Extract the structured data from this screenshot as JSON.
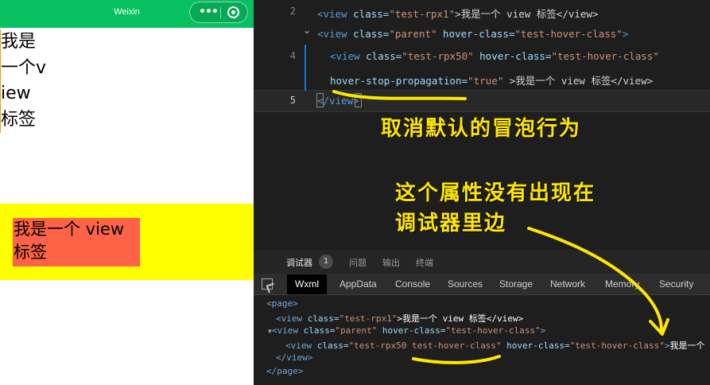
{
  "simulator": {
    "nav_title": "Weixin",
    "capsule_more": "•••",
    "view_rpx1_text": "我是一个view标签",
    "view_rpx50_text": "我是一个 view 标签",
    "colors": {
      "nav": "#07c160",
      "parent_bg": "#ffff00",
      "child_bg": "#ff6347"
    }
  },
  "editor": {
    "line_numbers": [
      "2",
      "4",
      "5"
    ],
    "lines": {
      "l2": [
        "<view ",
        "class=",
        "\"test-rpx1\"",
        ">我是一个 view 标签</view>"
      ],
      "l3": [
        "<view ",
        "class=",
        "\"parent\"",
        " hover-class=",
        "\"test-hover-class\"",
        ">"
      ],
      "l4": [
        "<view ",
        "class=",
        "\"test-rpx50\"",
        " hover-class=",
        "\"test-hover-class\""
      ],
      "l4b": [
        "hover-stop-propagation=",
        "\"true\"",
        " >我是一个 view 标签</view>"
      ],
      "l5": [
        "</view>"
      ]
    }
  },
  "annotations": {
    "a1": "取消默认的冒泡行为",
    "a2_line1": "这个属性没有出现在",
    "a2_line2": "调试器里边"
  },
  "devtools": {
    "top_tabs": [
      "调试器",
      "问题",
      "输出",
      "终端"
    ],
    "badge": "1",
    "tabs": [
      "Wxml",
      "AppData",
      "Console",
      "Sources",
      "Storage",
      "Network",
      "Memory",
      "Security"
    ],
    "wxml": {
      "r1": "<page>",
      "r2": [
        "<view ",
        "class=",
        "\"test-rpx1\"",
        ">我是一个 view 标签</view>"
      ],
      "r3": [
        "<view ",
        "class=",
        "\"parent\"",
        " hover-class=",
        "\"test-hover-class\"",
        ">"
      ],
      "r4": [
        "<view ",
        "class=",
        "\"test-rpx50 test-hover-class\"",
        " hover-class=",
        "\"test-hover-class\"",
        ">",
        "我是一个"
      ],
      "r5": "</view>",
      "r6": "</page>"
    }
  }
}
